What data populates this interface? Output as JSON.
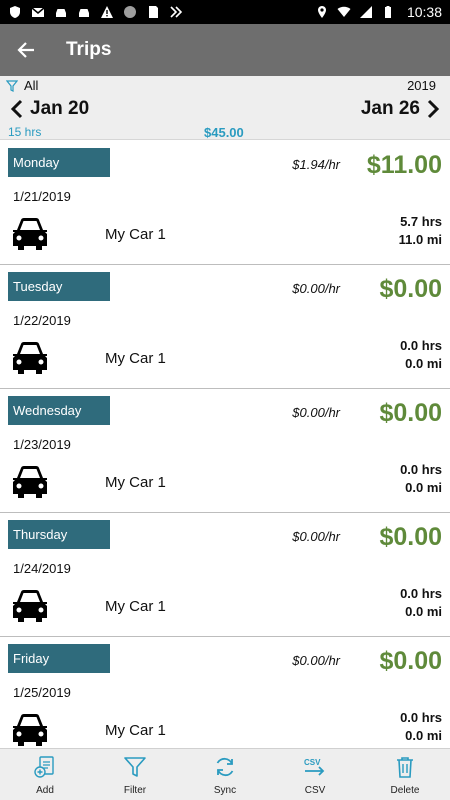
{
  "status_bar": {
    "time": "10:38",
    "icons": [
      "shield-icon",
      "gmail-icon",
      "car-icon",
      "car-icon",
      "alert-icon",
      "circle-icon",
      "sd-card-icon",
      "sync-icon"
    ],
    "right_icons": [
      "location-icon",
      "wifi-icon",
      "signal-icon",
      "battery-icon"
    ]
  },
  "app_bar": {
    "title": "Trips"
  },
  "week": {
    "filter_label": "All",
    "year": "2019",
    "start": "Jan 20",
    "end": "Jan 26",
    "total_hours": "15 hrs",
    "total_amount": "$45.00"
  },
  "days": [
    {
      "day": "Monday",
      "rate": "$1.94/hr",
      "earnings": "$11.00",
      "date": "1/21/2019",
      "vehicle": "My Car 1",
      "hours": "5.7 hrs",
      "miles": "11.0 mi"
    },
    {
      "day": "Tuesday",
      "rate": "$0.00/hr",
      "earnings": "$0.00",
      "date": "1/22/2019",
      "vehicle": "My Car 1",
      "hours": "0.0 hrs",
      "miles": "0.0 mi"
    },
    {
      "day": "Wednesday",
      "rate": "$0.00/hr",
      "earnings": "$0.00",
      "date": "1/23/2019",
      "vehicle": "My Car 1",
      "hours": "0.0 hrs",
      "miles": "0.0 mi"
    },
    {
      "day": "Thursday",
      "rate": "$0.00/hr",
      "earnings": "$0.00",
      "date": "1/24/2019",
      "vehicle": "My Car 1",
      "hours": "0.0 hrs",
      "miles": "0.0 mi"
    },
    {
      "day": "Friday",
      "rate": "$0.00/hr",
      "earnings": "$0.00",
      "date": "1/25/2019",
      "vehicle": "My Car 1",
      "hours": "0.0 hrs",
      "miles": "0.0 mi"
    }
  ],
  "bottom_bar": {
    "add": "Add",
    "filter": "Filter",
    "sync": "Sync",
    "csv": "CSV",
    "delete": "Delete",
    "csv_icon_text": "CSV"
  },
  "colors": {
    "app_bar": "#6e6e6e",
    "day_badge": "#2f6b7c",
    "earnings_green": "#5f8a3a",
    "accent_blue": "#2a9bc0"
  }
}
